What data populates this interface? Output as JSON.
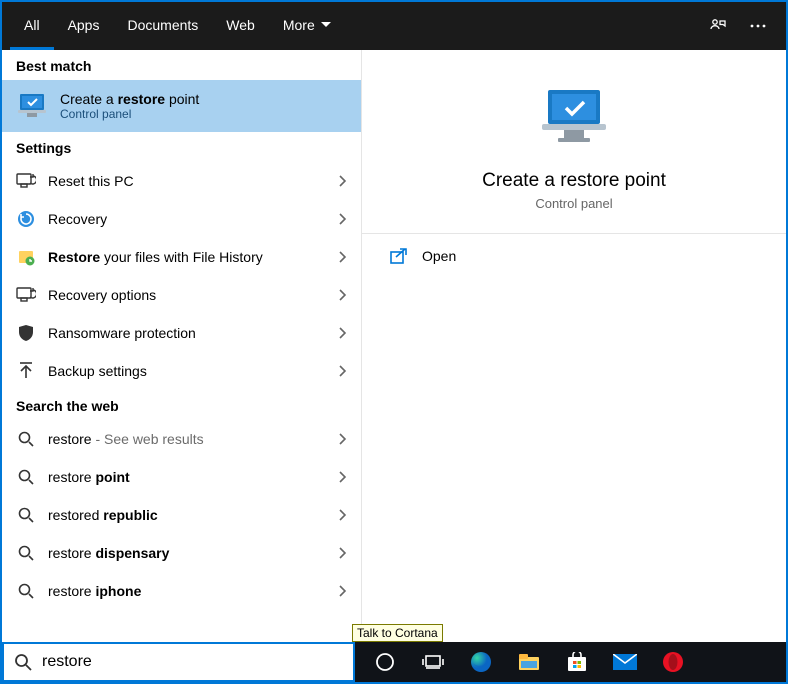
{
  "tabs": {
    "all": "All",
    "apps": "Apps",
    "documents": "Documents",
    "web": "Web",
    "more": "More"
  },
  "sections": {
    "best_match": "Best match",
    "settings": "Settings",
    "search_web": "Search the web"
  },
  "best_match": {
    "title_pre": "Create a ",
    "title_bold": "restore",
    "title_post": " point",
    "subtitle": "Control panel"
  },
  "settings_items": [
    {
      "label_plain": "Reset this PC",
      "label_bold": ""
    },
    {
      "label_plain": "Recovery",
      "label_bold": ""
    },
    {
      "label_bold": "Restore",
      "label_plain": " your files with File History"
    },
    {
      "label_plain": "Recovery options",
      "label_bold": ""
    },
    {
      "label_plain": "Ransomware protection",
      "label_bold": ""
    },
    {
      "label_plain": "Backup settings",
      "label_bold": ""
    }
  ],
  "web_items": [
    {
      "term": "restore",
      "suffix": " - See web results"
    },
    {
      "term": "restore ",
      "bold": "point"
    },
    {
      "term": "restored ",
      "bold": "republic"
    },
    {
      "term": "restore ",
      "bold": "dispensary"
    },
    {
      "term": "restore ",
      "bold": "iphone"
    }
  ],
  "preview": {
    "title": "Create a restore point",
    "subtitle": "Control panel",
    "open": "Open"
  },
  "tooltip": "Talk to Cortana",
  "search": {
    "value": "restore"
  }
}
